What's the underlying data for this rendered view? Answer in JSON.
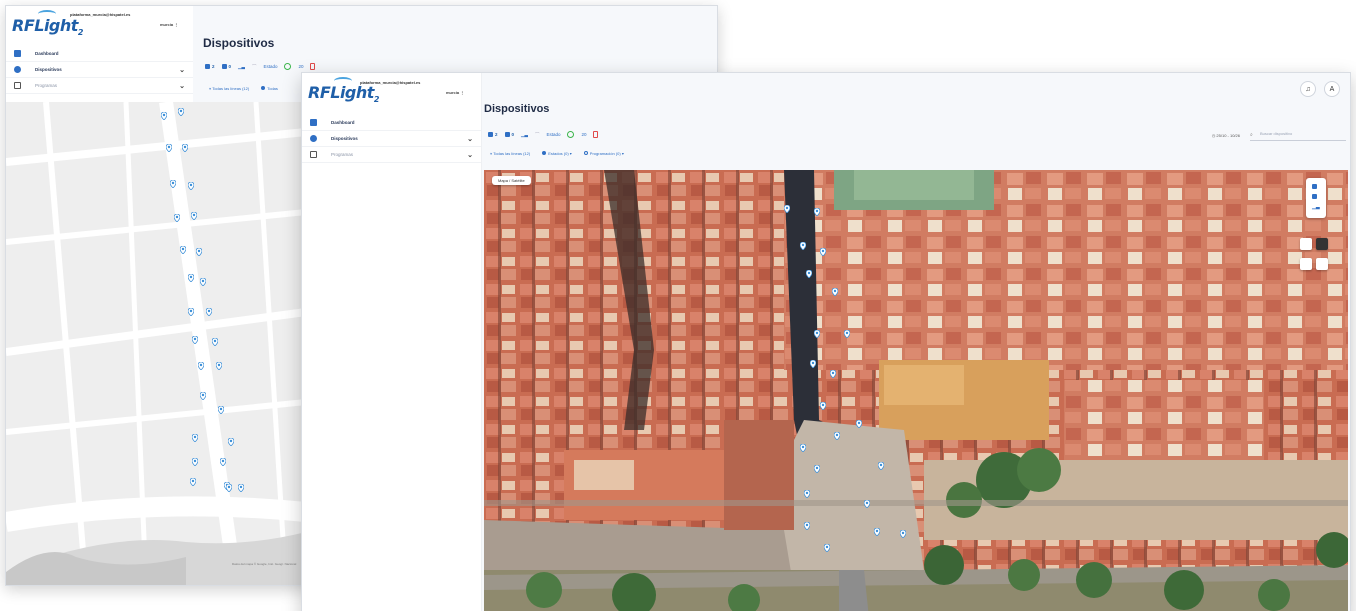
{
  "app": {
    "logo_text": "RFLight",
    "logo_sub": "2",
    "user_email": "plataforma_murcia@hispatel.es",
    "user_role": "murcia"
  },
  "sidebar": {
    "items": [
      {
        "label": "Dashboard",
        "icon": "dashboard-icon"
      },
      {
        "label": "Dispositivos",
        "icon": "devices-icon"
      },
      {
        "label": "Programas",
        "icon": "calendar-icon"
      }
    ]
  },
  "main": {
    "page_title": "Dispositivos",
    "toolbar": {
      "count_a": "2",
      "count_b": "0",
      "estado_label": "Estado",
      "alerts_count": "20"
    },
    "filters": {
      "lines": "Todas las líneas (12)",
      "lines_short": "Todas las líneas (12)",
      "lines_partial_back": "Todas",
      "status": "Estados (0)",
      "programs": "Programación (0)"
    },
    "date_range": "25/10 - 10/26",
    "search_placeholder": "Buscar dispositivo",
    "map_button": "Mapa / Satélite"
  },
  "map": {
    "attribution": "Datos del mapa © Google, Inst. Geogr. Nacional",
    "colors": {
      "street_map_bg": "#efefef",
      "pin": "#3b8fd8"
    }
  },
  "colors": {
    "brand": "#1f5fa8",
    "accent": "#2f6fc4",
    "ok": "#3bb54a",
    "alert": "#e04a4a"
  }
}
